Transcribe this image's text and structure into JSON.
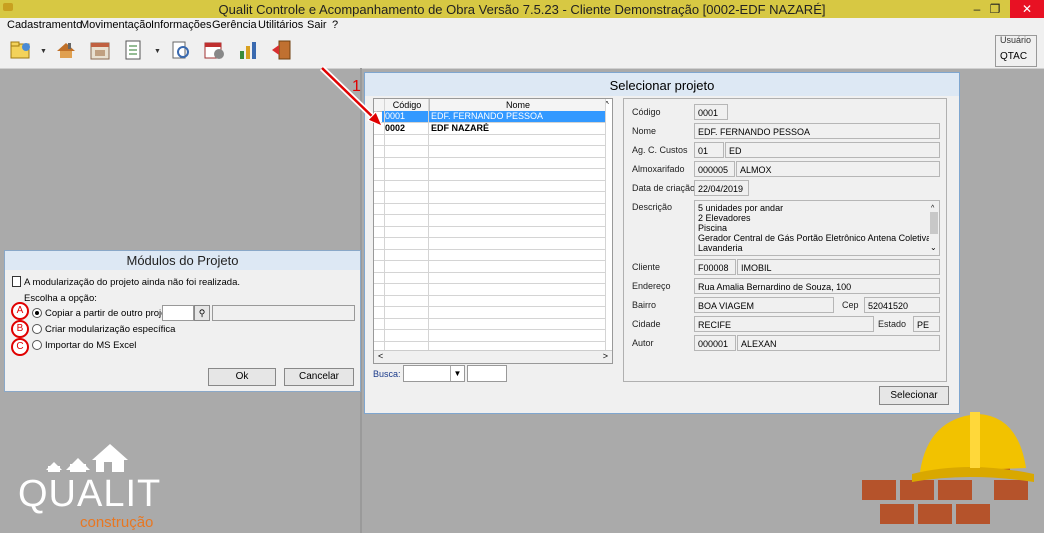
{
  "window": {
    "title": "Qualit Controle e Acompanhamento de Obra Versão 7.5.23 - Cliente Demonstração [0002-EDF NAZARÉ]"
  },
  "menu": [
    "Cadastramento",
    "Movimentação",
    "Informações",
    "Gerência",
    "Utilitários",
    "Sair",
    "?"
  ],
  "toolbar": {
    "icons": [
      "project-icon",
      "tools-icon",
      "building-calendar-icon",
      "document-list-icon",
      "reports-icon",
      "schedule-icon",
      "chart-icon",
      "exit-door-icon"
    ],
    "user_label": "Usuário",
    "user_value": "QTAC"
  },
  "modulos": {
    "title": "Módulos do Projeto",
    "notice": "A modularização do projeto ainda não foi realizada.",
    "choose": "Escolha a opção:",
    "options": [
      {
        "marker": "A",
        "label": "Copiar a partir de outro projeto",
        "selected": true
      },
      {
        "marker": "B",
        "label": "Criar modularização específica",
        "selected": false
      },
      {
        "marker": "C",
        "label": "Importar do MS Excel",
        "selected": false
      }
    ],
    "ok": "Ok",
    "cancel": "Cancelar"
  },
  "annotation": {
    "step": "1"
  },
  "selecionar": {
    "title": "Selecionar projeto",
    "grid": {
      "headers": [
        "Código",
        "Nome"
      ],
      "rows": [
        {
          "codigo": "0001",
          "nome": "EDF. FERNANDO PESSOA",
          "selected": true
        },
        {
          "codigo": "0002",
          "nome": "EDF NAZARÉ",
          "selected": false
        }
      ]
    },
    "busca_label": "Busca:",
    "details": {
      "codigo_label": "Código",
      "codigo": "0001",
      "nome_label": "Nome",
      "nome": "EDF. FERNANDO PESSOA",
      "ag_label": "Ag. C. Custos",
      "ag_code": "01",
      "ag_name": "ED",
      "almox_label": "Almoxarifado",
      "almox_code": "000005",
      "almox_name": "ALMOX",
      "data_label": "Data de criação",
      "data": "22/04/2019",
      "descricao_label": "Descrição",
      "descricao": [
        "5 unidades por andar",
        "2 Elevadores",
        "Piscina",
        "Gerador Central de Gás Portão Eletrônico Antena Coletiva",
        "Lavanderia"
      ],
      "cliente_label": "Cliente",
      "cliente_code": "F00008",
      "cliente_name": "IMOBIL",
      "endereco_label": "Endereço",
      "endereco": "Rua Amalia Bernardino de Souza, 100",
      "bairro_label": "Bairro",
      "bairro": "BOA VIAGEM",
      "cep_label": "Cep",
      "cep": "52041520",
      "cidade_label": "Cidade",
      "cidade": "RECIFE",
      "estado_label": "Estado",
      "estado": "PE",
      "autor_label": "Autor",
      "autor_code": "000001",
      "autor_name": "ALEXAN"
    },
    "selecionar_button": "Selecionar"
  },
  "logo": {
    "brand": "QUALIT",
    "sub": "construção"
  },
  "colors": {
    "titlebar": "#d7c843",
    "selection": "#3399ff",
    "annotation": "#e00000",
    "logo_orange": "#e87722"
  }
}
